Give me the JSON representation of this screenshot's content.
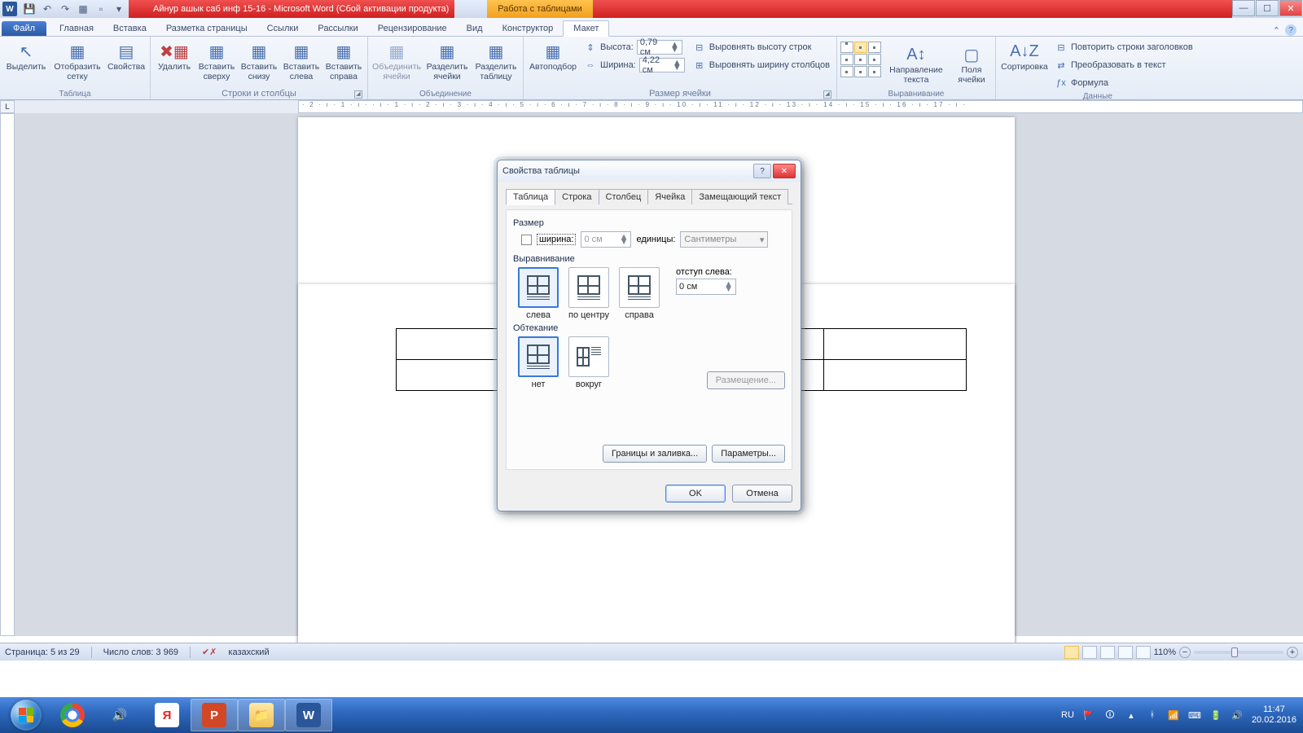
{
  "titlebar": {
    "doc_title": "Айнур ашык саб инф 15-16  -  Microsoft Word (Сбой активации продукта)",
    "context_title": "Работа с таблицами"
  },
  "tabs": {
    "file": "Файл",
    "list": [
      "Главная",
      "Вставка",
      "Разметка страницы",
      "Ссылки",
      "Рассылки",
      "Рецензирование",
      "Вид"
    ],
    "ctx": [
      "Конструктор",
      "Макет"
    ],
    "active": "Макет"
  },
  "ribbon": {
    "g_table": {
      "label": "Таблица",
      "select": "Выделить",
      "grid": "Отобразить сетку",
      "props": "Свойства"
    },
    "g_rowscols": {
      "label": "Строки и столбцы",
      "del": "Удалить",
      "ins_top": "Вставить сверху",
      "ins_bot": "Вставить снизу",
      "ins_left": "Вставить слева",
      "ins_right": "Вставить справа"
    },
    "g_merge": {
      "label": "Объединение",
      "merge": "Объединить ячейки",
      "split": "Разделить ячейки",
      "splittbl": "Разделить таблицу"
    },
    "g_size": {
      "label": "Размер ячейки",
      "autofit": "Автоподбор",
      "h_lbl": "Высота:",
      "h_val": "0,79 см",
      "w_lbl": "Ширина:",
      "w_val": "4,22 см",
      "dist_rows": "Выровнять высоту строк",
      "dist_cols": "Выровнять ширину столбцов"
    },
    "g_align": {
      "label": "Выравнивание",
      "dir": "Направление текста",
      "margins": "Поля ячейки"
    },
    "g_data": {
      "label": "Данные",
      "sort": "Сортировка",
      "repeat": "Повторить строки заголовков",
      "convert": "Преобразовать в текст",
      "formula": "Формула"
    }
  },
  "dialog": {
    "title": "Свойства таблицы",
    "tabs": [
      "Таблица",
      "Строка",
      "Столбец",
      "Ячейка",
      "Замещающий текст"
    ],
    "active_tab": "Таблица",
    "size_section": "Размер",
    "width_chk": "ширина:",
    "width_val": "0 см",
    "units_lbl": "единицы:",
    "units_val": "Сантиметры",
    "align_section": "Выравнивание",
    "align_left": "слева",
    "align_center": "по центру",
    "align_right": "справа",
    "indent_lbl": "отступ слева:",
    "indent_val": "0 см",
    "wrap_section": "Обтекание",
    "wrap_none": "нет",
    "wrap_around": "вокруг",
    "placement_btn": "Размещение...",
    "borders_btn": "Границы и заливка...",
    "options_btn": "Параметры...",
    "ok": "OK",
    "cancel": "Отмена"
  },
  "statusbar": {
    "page": "Страница: 5 из 29",
    "words": "Число слов: 3 969",
    "lang": "казахский",
    "zoom": "110%"
  },
  "taskbar": {
    "lang": "RU",
    "time": "11:47",
    "date": "20.02.2016"
  },
  "ruler": "· 2 · ı · 1 · ı ·  · ı · 1 · ı · 2 · ı · 3 · ı · 4 · ı · 5 · ı · 6 · ı · 7 · ı · 8 · ı · 9 · ı · 10 · ı · 11 · ı · 12 · ı · 13 · ı · 14 · ı · 15 · ı · 16 · ı · 17 · ı ·"
}
